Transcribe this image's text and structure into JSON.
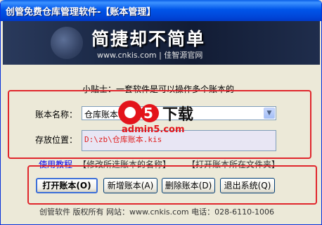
{
  "window": {
    "title": "创管免费仓库管理软件-【账本管理】"
  },
  "banner": {
    "headline": "简捷却不简单",
    "subline": "www.cnkis.com | 佳智源官网"
  },
  "tip": "小贴士：一套软件是可以操作多个账本的",
  "form": {
    "book_name_label": "账本名称：",
    "book_name_value": "仓库账本",
    "storage_label": "存放位置：",
    "storage_value": "D:\\zb\\仓库账本.kis"
  },
  "links": {
    "tutorial": "使用教程",
    "rename": "【修改所选账本的名称】",
    "open_folder": "【打开账本所在文件夹】"
  },
  "buttons": {
    "open": "打开账本(O)",
    "new": "新增账本(A)",
    "delete": "删除账本(D)",
    "exit": "退出系统(Q)"
  },
  "footer": "创管软件  版权所有  网站：www.cnkis.com    电话：028-6110-1006",
  "watermark": {
    "brand": "下载",
    "site": "admin5.com"
  },
  "colors": {
    "title_bar": "#0055ea",
    "highlight_box": "#e0262c",
    "path_text": "#e0201f",
    "link": "#0000ee"
  }
}
